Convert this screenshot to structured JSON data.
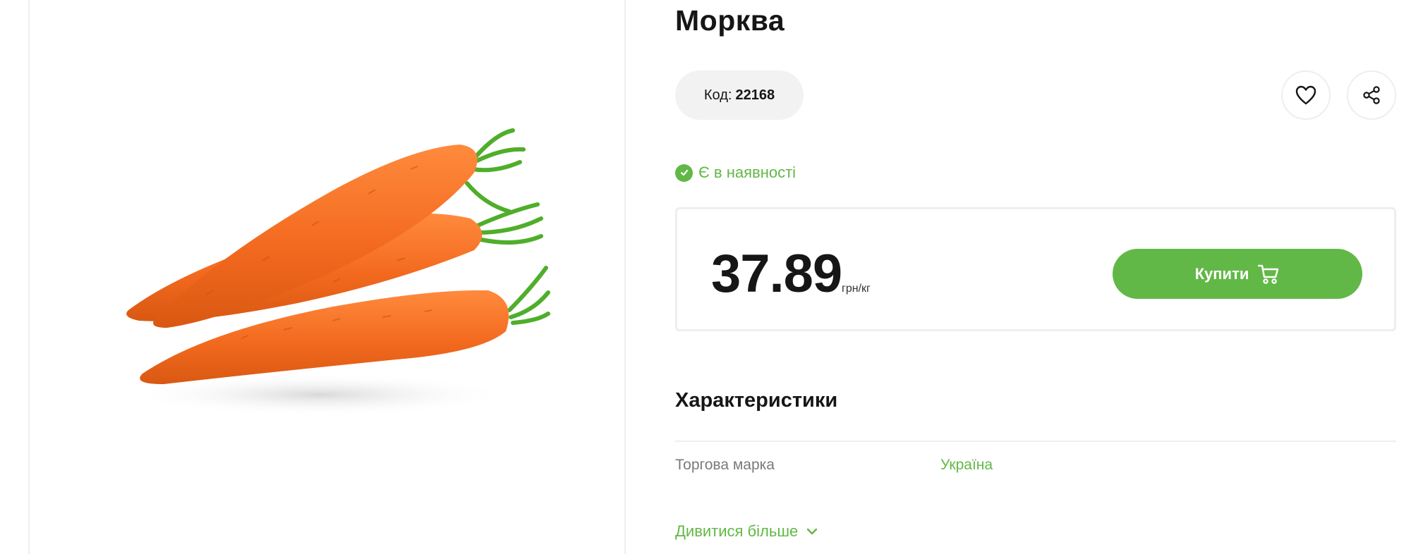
{
  "product": {
    "title": "Морква",
    "code_label": "Код:",
    "code_value": "22168",
    "stock_status": "Є в наявності",
    "price": "37.89",
    "unit": "грн/кг",
    "buy_label": "Купити",
    "image_subject": "carrots"
  },
  "icons": {
    "favorite": "heart-icon",
    "share": "share-icon",
    "stock": "check-circle-icon",
    "cart": "cart-icon",
    "more": "chevron-down-icon"
  },
  "specs": {
    "title": "Характеристики",
    "rows": [
      {
        "label": "Торгова марка",
        "value": "Україна"
      }
    ],
    "more_label": "Дивитися більше"
  },
  "colors": {
    "accent": "#62b846",
    "text": "#161616",
    "muted": "#7a7a7a",
    "pill_bg": "#f2f2f2",
    "border": "#eeeeee"
  }
}
